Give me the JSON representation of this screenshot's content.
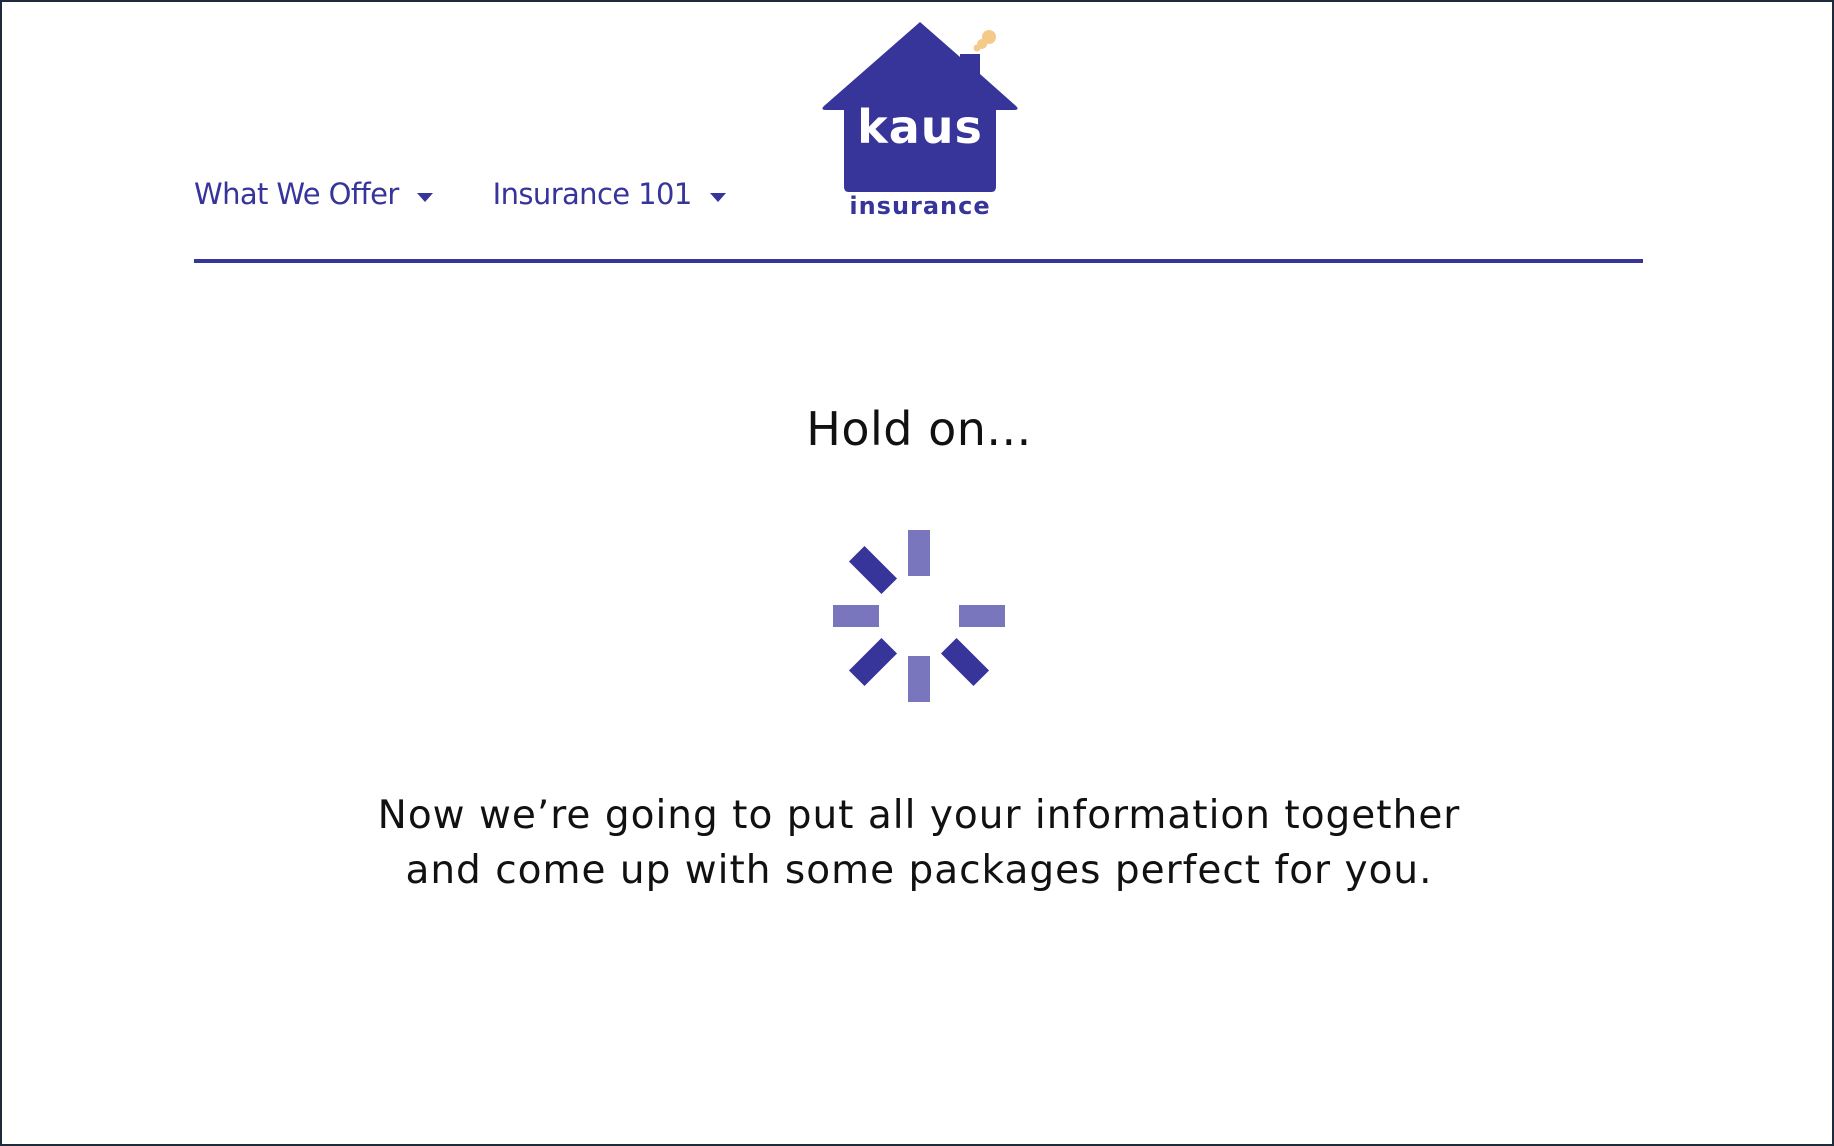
{
  "nav": {
    "items": [
      {
        "label": "What We Offer",
        "icon": "caret-down-icon"
      },
      {
        "label": "Insurance 101",
        "icon": "caret-down-icon"
      }
    ]
  },
  "logo": {
    "wordmark": "kaus",
    "subtitle": "insurance",
    "icon": "house-logo-icon"
  },
  "loading": {
    "heading": "Hold on...",
    "message_lines": [
      "Now we’re going to put all your information together",
      "and come up with some packages perfect for you."
    ],
    "spinner_icon": "loading-spinner-icon"
  },
  "colors": {
    "brand": "#37349a",
    "brand_light": "#7a76bd",
    "smoke": "#f5c98a",
    "text": "#111111",
    "frame_border": "#1d2b3a"
  }
}
